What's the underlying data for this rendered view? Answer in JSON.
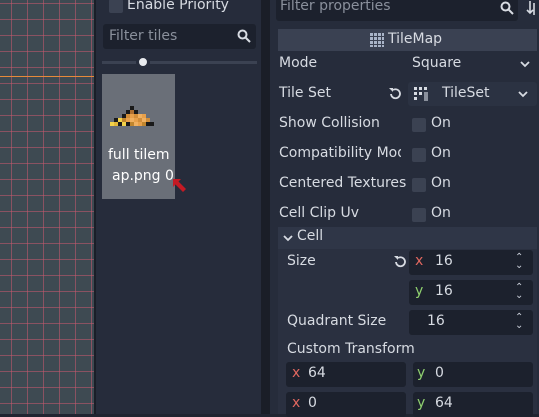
{
  "tiles_panel": {
    "enable_priority_label": "Enable Priority",
    "filter_placeholder": "Filter tiles",
    "tile_label_line1": "full tilem",
    "tile_label_line2": "ap.png 0"
  },
  "inspector": {
    "filter_placeholder": "Filter properties",
    "section_title": "TileMap",
    "properties": {
      "mode": {
        "label": "Mode",
        "value": "Square"
      },
      "tile_set": {
        "label": "Tile Set",
        "value": "TileSet"
      },
      "show_collision": {
        "label": "Show Collision",
        "value": "On"
      },
      "compatibility_mode": {
        "label": "Compatibility Mod",
        "value": "On"
      },
      "centered_textures": {
        "label": "Centered Textures",
        "value": "On"
      },
      "cell_clip_uv": {
        "label": "Cell Clip Uv",
        "value": "On"
      }
    },
    "cell": {
      "title": "Cell",
      "size_label": "Size",
      "size_x": "16",
      "size_y": "16",
      "quadrant_label": "Quadrant Size",
      "quadrant_value": "16",
      "custom_transform_label": "Custom Transform",
      "transform": {
        "xx": "64",
        "xy": "0",
        "yx": "0",
        "yy": "64"
      },
      "axis_x": "x",
      "axis_y": "y"
    }
  },
  "colors": {
    "accent_red": "#e0675f",
    "accent_green": "#8fd06f",
    "viewport_bg": "#3e4a52",
    "grid_line": "#c85a6e"
  }
}
